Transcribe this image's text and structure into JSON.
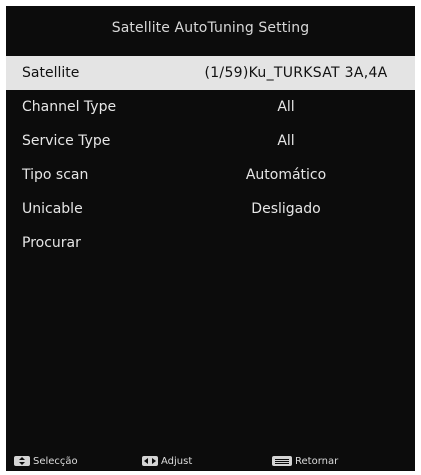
{
  "title": "Satellite AutoTuning Setting",
  "menu": [
    {
      "label": "Satellite",
      "value": "(1/59)Ku_TURKSAT 3A,4A"
    },
    {
      "label": "Channel Type",
      "value": "All"
    },
    {
      "label": "Service Type",
      "value": "All"
    },
    {
      "label": "Tipo scan",
      "value": "Automático"
    },
    {
      "label": "Unicable",
      "value": "Desligado"
    },
    {
      "label": "Procurar",
      "value": ""
    }
  ],
  "footer": {
    "select": {
      "icon": "up-down-icon",
      "label": "Selecção"
    },
    "adjust": {
      "icon": "left-right-icon",
      "label": "Adjust"
    },
    "return": {
      "icon": "menu-key-icon",
      "label": "Retornar"
    }
  },
  "colors": {
    "background": "#0c0c0c",
    "highlight": "#e4e4e4",
    "text": "#e6e6e6"
  }
}
